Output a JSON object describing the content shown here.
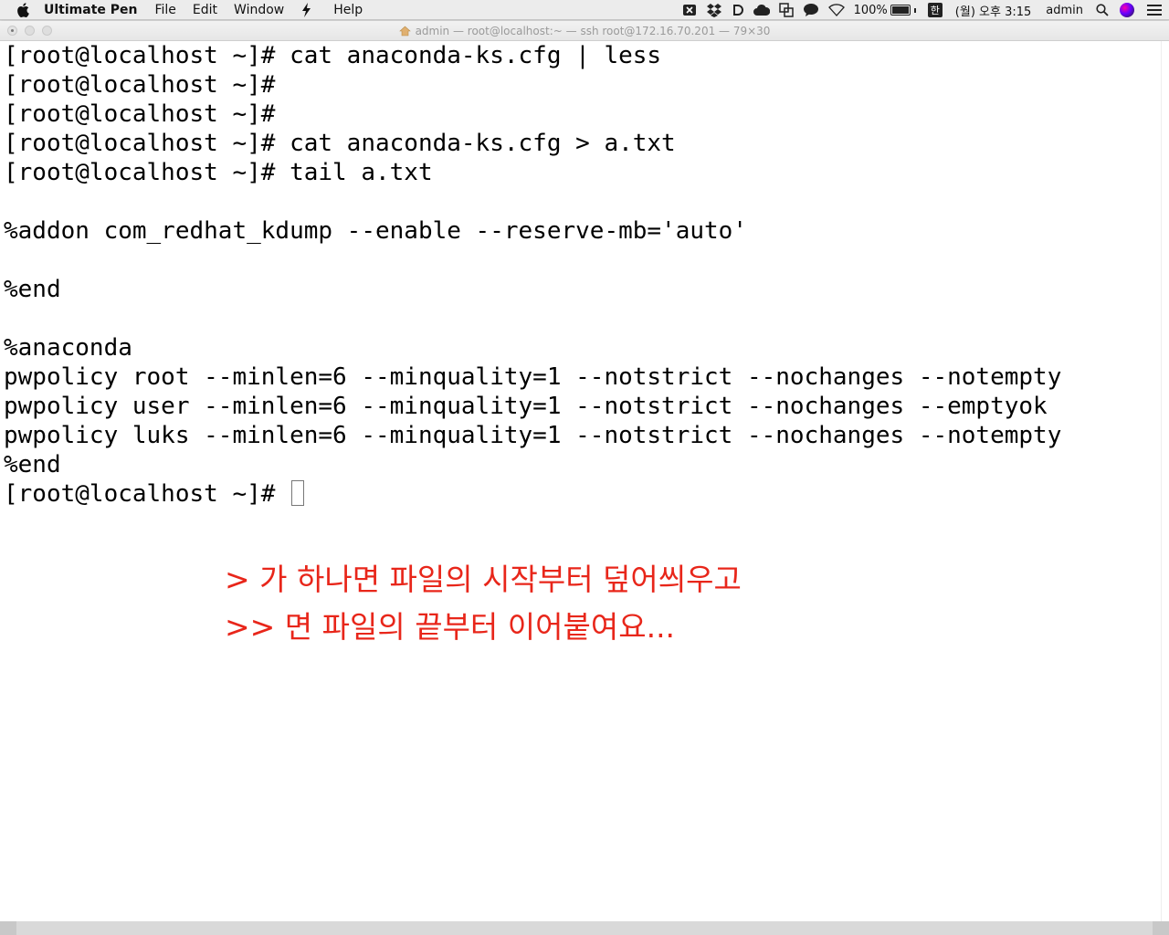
{
  "menubar": {
    "app_name": "Ultimate Pen",
    "menus": [
      "File",
      "Edit",
      "Window",
      "Help"
    ],
    "battery": "100%",
    "ime_label": "한",
    "clock": "(월) 오후 3:15",
    "user": "admin"
  },
  "window": {
    "title": "admin — root@localhost:~ — ssh root@172.16.70.201 — 79×30"
  },
  "terminal": {
    "lines": [
      "[root@localhost ~]# cat anaconda-ks.cfg | less",
      "[root@localhost ~]#",
      "[root@localhost ~]#",
      "[root@localhost ~]# cat anaconda-ks.cfg > a.txt",
      "[root@localhost ~]# tail a.txt",
      "",
      "%addon com_redhat_kdump --enable --reserve-mb='auto'",
      "",
      "%end",
      "",
      "%anaconda",
      "pwpolicy root --minlen=6 --minquality=1 --notstrict --nochanges --notempty",
      "pwpolicy user --minlen=6 --minquality=1 --notstrict --nochanges --emptyok",
      "pwpolicy luks --minlen=6 --minquality=1 --notstrict --nochanges --notempty",
      "%end"
    ],
    "prompt": "[root@localhost ~]# "
  },
  "annotations": {
    "line1": "> 가 하나면 파일의 시작부터 덮어씌우고",
    "line2": ">> 면 파일의 끝부터 이어붙여요..."
  },
  "colors": {
    "annotation": "#e8261a",
    "terminal_text": "#000000",
    "terminal_bg": "#ffffff"
  }
}
